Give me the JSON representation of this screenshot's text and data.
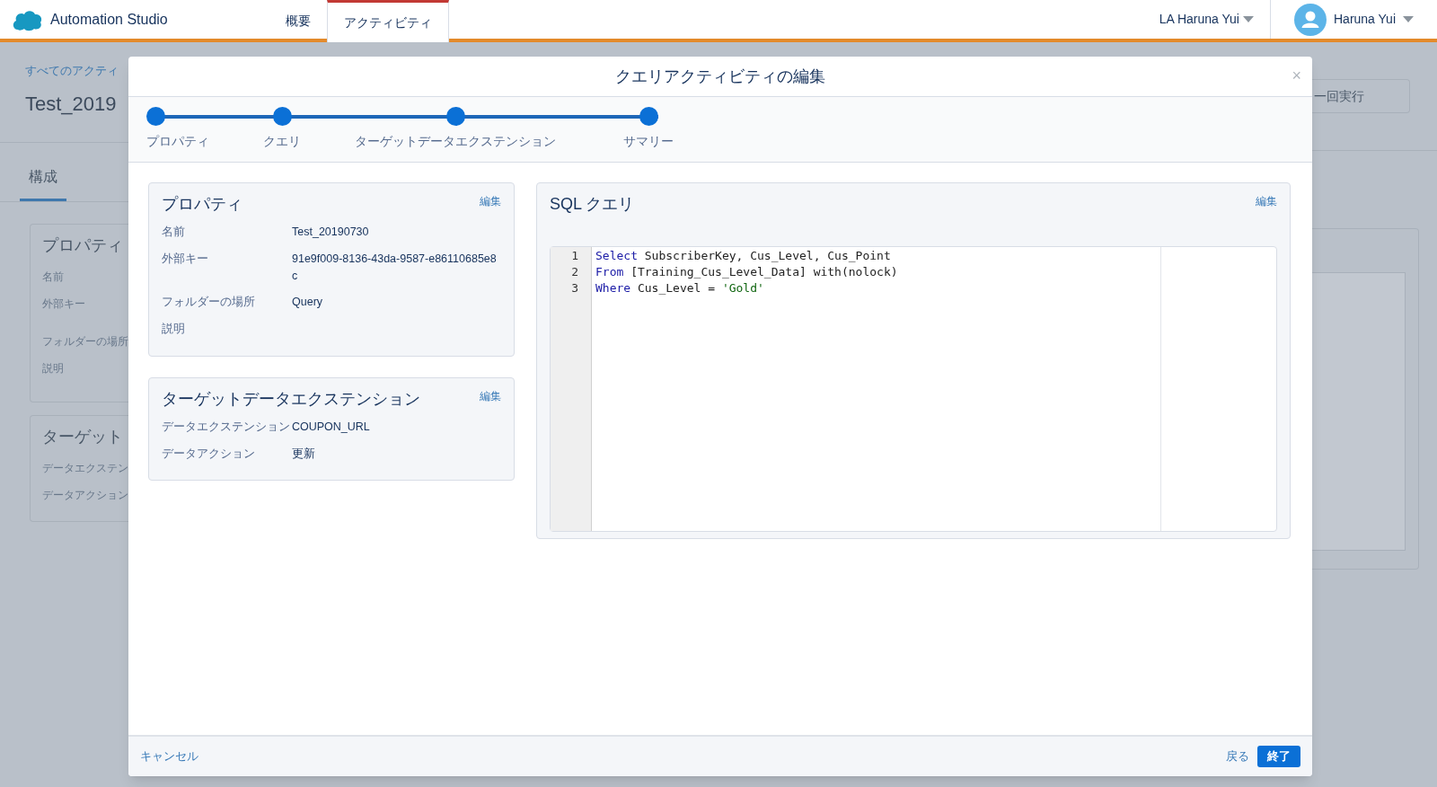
{
  "header": {
    "app_name": "Automation Studio",
    "tabs": [
      {
        "label": "概要",
        "selected": false
      },
      {
        "label": "アクティビティ",
        "selected": true
      }
    ],
    "account": "LA Haruna Yui",
    "user": "Haruna Yui"
  },
  "background": {
    "breadcrumb": "すべてのアクティ",
    "title": "Test_2019",
    "tab": "構成",
    "card1": {
      "title": "プロパティ",
      "labels": [
        "名前",
        "外部キー",
        "フォルダーの場所",
        "説明"
      ]
    },
    "card2": {
      "title": "ターゲット",
      "labels": [
        "データエクステン",
        "データアクション"
      ]
    },
    "run_button": "一回実行"
  },
  "modal": {
    "title": "クエリアクティビティの編集",
    "close": "×",
    "steps": [
      {
        "label": "プロパティ",
        "completed": true
      },
      {
        "label": "クエリ",
        "completed": true
      },
      {
        "label": "ターゲットデータエクステンション",
        "completed": true
      },
      {
        "label": "サマリー",
        "completed": true
      }
    ],
    "properties": {
      "title": "プロパティ",
      "edit": "編集",
      "fields": [
        {
          "label": "名前",
          "value": "Test_20190730"
        },
        {
          "label": "外部キー",
          "value": "91e9f009-8136-43da-9587-e86110685e8c"
        },
        {
          "label": "フォルダーの場所",
          "value": "Query"
        },
        {
          "label": "説明"
        }
      ]
    },
    "target": {
      "title": "ターゲットデータエクステンション",
      "edit": "編集",
      "fields": [
        {
          "label": "データエクステンション",
          "value": "COUPON_URL"
        },
        {
          "label": "データアクション",
          "value": "更新"
        }
      ]
    },
    "sql": {
      "title": "SQL クエリ",
      "edit": "編集",
      "lines": [
        {
          "number": "1",
          "tokens": [
            {
              "kind": "keyword",
              "text": "Select"
            },
            {
              "kind": "plain",
              "text": " SubscriberKey, Cus_Level, Cus_Point"
            }
          ]
        },
        {
          "number": "2",
          "tokens": [
            {
              "kind": "keyword",
              "text": "From"
            },
            {
              "kind": "plain",
              "text": " [Training_Cus_Level_Data] with(nolock)"
            }
          ]
        },
        {
          "number": "3",
          "tokens": [
            {
              "kind": "keyword",
              "text": "Where"
            },
            {
              "kind": "plain",
              "text": " Cus_Level = "
            },
            {
              "kind": "string",
              "text": "'Gold'"
            }
          ]
        }
      ]
    },
    "footer": {
      "cancel": "キャンセル",
      "back": "戻る",
      "finish": "終了"
    }
  }
}
